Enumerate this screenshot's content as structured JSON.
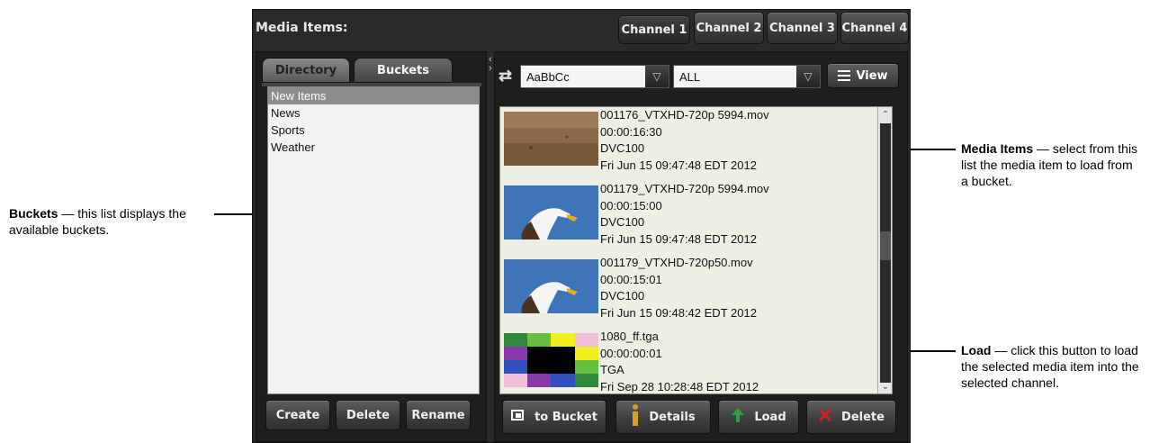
{
  "callouts": {
    "buckets": {
      "term": "Buckets",
      "text": " — this list displays the available buckets."
    },
    "media_items": {
      "term": "Media Items",
      "text": " — select from this list the media item to load from a bucket."
    },
    "load": {
      "term": "Load",
      "text": " — click this button to load the selected media item into the selected channel."
    }
  },
  "panel": {
    "title": "Media Items:",
    "channels": [
      "Channel 1",
      "Channel 2",
      "Channel 3",
      "Channel 4"
    ],
    "active_channel": "Channel 1"
  },
  "left": {
    "tabs": {
      "directory": "Directory",
      "buckets": "Buckets"
    },
    "buckets": [
      "New Items",
      "News",
      "Sports",
      "Weather"
    ],
    "selected_bucket": "New Items",
    "buttons": {
      "create": "Create",
      "delete": "Delete",
      "rename": "Rename"
    }
  },
  "right": {
    "filter_value": "AaBbCc",
    "type_value": "ALL",
    "view_label": "View",
    "media": [
      {
        "name": "001176_VTXHD-720p 5994.mov",
        "duration": "00:00:16:30",
        "codec": "DVC100",
        "date": "Fri Jun 15 09:47:48 EDT 2012",
        "thumb": "field"
      },
      {
        "name": "001179_VTXHD-720p 5994.mov",
        "duration": "00:00:15:00",
        "codec": "DVC100",
        "date": "Fri Jun 15 09:47:48 EDT 2012",
        "thumb": "eagle"
      },
      {
        "name": "001179_VTXHD-720p50.mov",
        "duration": "00:00:15:01",
        "codec": "DVC100",
        "date": "Fri Jun 15 09:48:42 EDT 2012",
        "thumb": "eagle"
      },
      {
        "name": "1080_ff.tga",
        "duration": "00:00:00:01",
        "codec": "TGA",
        "date": "Fri Sep 28 10:28:48 EDT 2012",
        "thumb": "colorbars"
      }
    ],
    "buttons": {
      "to_bucket": "to Bucket",
      "details": "Details",
      "load": "Load",
      "delete": "Delete"
    }
  },
  "colors": {
    "panel_bg": "#2a2a2a",
    "list_bg": "#eeeee4",
    "load_icon": "#2e9e3e",
    "delete_icon": "#d22020",
    "details_icon": "#d8a020"
  }
}
